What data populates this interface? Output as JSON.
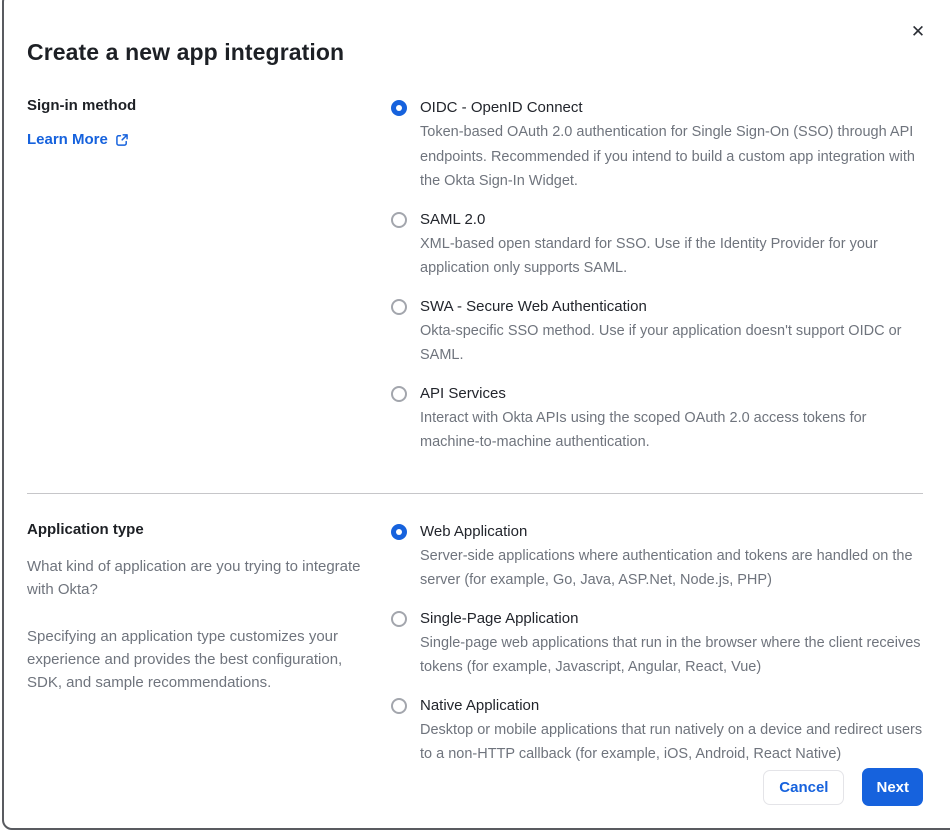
{
  "dialog": {
    "title": "Create a new app integration",
    "close_glyph": "✕"
  },
  "colors": {
    "accent_blue": "#1662dd",
    "text_dark": "#1d2025",
    "text_gray": "#6f747d",
    "divider": "#c6c6c9",
    "frame_border": "#595b60",
    "radio_unselected_border": "#a3a6ad"
  },
  "signin_section": {
    "label": "Sign-in method",
    "learn_more_label": "Learn More",
    "options": [
      {
        "label": "OIDC - OpenID Connect",
        "description": "Token-based OAuth 2.0 authentication for Single Sign-On (SSO) through API endpoints. Recommended if you intend to build a custom app integration with the Okta Sign-In Widget.",
        "selected": true
      },
      {
        "label": "SAML 2.0",
        "description": "XML-based open standard for SSO. Use if the Identity Provider for your application only supports SAML.",
        "selected": false
      },
      {
        "label": "SWA - Secure Web Authentication",
        "description": "Okta-specific SSO method. Use if your application doesn't support OIDC or SAML.",
        "selected": false
      },
      {
        "label": "API Services",
        "description": "Interact with Okta APIs using the scoped OAuth 2.0 access tokens for machine-to-machine authentication.",
        "selected": false
      }
    ]
  },
  "apptype_section": {
    "label": "Application type",
    "paragraph1": "What kind of application are you trying to integrate with Okta?",
    "paragraph2": "Specifying an application type customizes your experience and provides the best configuration, SDK, and sample recommendations.",
    "options": [
      {
        "label": "Web Application",
        "description": "Server-side applications where authentication and tokens are handled on the server (for example, Go, Java, ASP.Net, Node.js, PHP)",
        "selected": true
      },
      {
        "label": "Single-Page Application",
        "description": "Single-page web applications that run in the browser where the client receives tokens (for example, Javascript, Angular, React, Vue)",
        "selected": false
      },
      {
        "label": "Native Application",
        "description": "Desktop or mobile applications that run natively on a device and redirect users to a non-HTTP callback (for example, iOS, Android, React Native)",
        "selected": false
      }
    ]
  },
  "footer": {
    "cancel_label": "Cancel",
    "next_label": "Next"
  }
}
